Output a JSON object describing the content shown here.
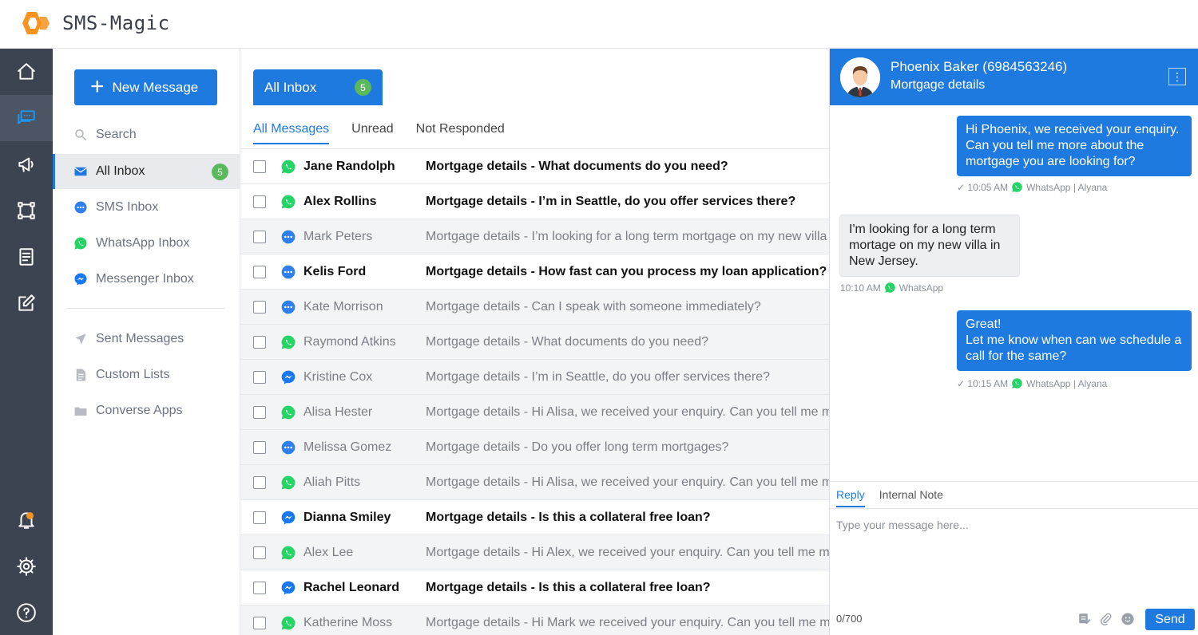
{
  "app": {
    "name": "SMS-Magic"
  },
  "rail": {
    "items": [
      "home-icon",
      "conversations-icon",
      "campaign-icon",
      "automation-icon",
      "templates-icon",
      "compose-icon",
      "notifications-icon",
      "settings-icon",
      "help-icon"
    ]
  },
  "folders": {
    "new_message_label": "New Message",
    "search_label": "Search",
    "items": [
      {
        "label": "All Inbox",
        "count": "5"
      },
      {
        "label": "SMS Inbox"
      },
      {
        "label": "WhatsApp Inbox"
      },
      {
        "label": "Messenger Inbox"
      }
    ],
    "secondary": [
      {
        "label": "Sent Messages"
      },
      {
        "label": "Custom Lists"
      },
      {
        "label": "Converse Apps"
      }
    ]
  },
  "list": {
    "inbox_tab": {
      "label": "All Inbox",
      "count": "5"
    },
    "filters": [
      "All Messages",
      "Unread",
      "Not Responded"
    ],
    "rows": [
      {
        "channel": "whatsapp",
        "name": "Jane Randolph",
        "subject": "Mortgage details - What documents do you need?",
        "unread": true
      },
      {
        "channel": "whatsapp",
        "name": "Alex Rollins",
        "subject": "Mortgage details - I’m in Seattle, do you offer services there?",
        "unread": true
      },
      {
        "channel": "sms",
        "name": "Mark Peters",
        "subject": "Mortgage details - I’m looking for a long term mortgage on my new villa in New Jersey",
        "unread": false
      },
      {
        "channel": "sms",
        "name": "Kelis Ford",
        "subject": "Mortgage details - How fast can you process my loan application?",
        "unread": true
      },
      {
        "channel": "sms",
        "name": "Kate Morrison",
        "subject": "Mortgage details - Can I speak with someone immediately?",
        "unread": false
      },
      {
        "channel": "whatsapp",
        "name": "Raymond Atkins",
        "subject": "Mortgage details - What documents do you need?",
        "unread": false
      },
      {
        "channel": "messenger",
        "name": "Kristine Cox",
        "subject": "Mortgage details - I’m in Seattle, do you offer services there?",
        "unread": false
      },
      {
        "channel": "whatsapp",
        "name": "Alisa Hester",
        "subject": "Mortgage details - Hi Alisa, we received your enquiry. Can you tell me more",
        "unread": false
      },
      {
        "channel": "sms",
        "name": "Melissa Gomez",
        "subject": "Mortgage details - Do you offer long term mortgages?",
        "unread": false
      },
      {
        "channel": "whatsapp",
        "name": "Aliah Pitts",
        "subject": "Mortgage details - Hi Alisa, we received your enquiry. Can you tell me more",
        "unread": false
      },
      {
        "channel": "messenger",
        "name": "Dianna Smiley",
        "subject": "Mortgage details - Is this a collateral free loan?",
        "unread": true
      },
      {
        "channel": "whatsapp",
        "name": "Alex Lee",
        "subject": "Mortgage details - Hi Alex, we received your enquiry. Can you tell me more",
        "unread": false
      },
      {
        "channel": "messenger",
        "name": "Rachel Leonard",
        "subject": "Mortgage details - Is this a collateral free loan?",
        "unread": true
      },
      {
        "channel": "whatsapp",
        "name": "Katherine Moss",
        "subject": "Mortgage details - Hi Mark  we received your enquiry. Can you tell me more",
        "unread": false
      }
    ]
  },
  "chat": {
    "contact": "Phoenix Baker (6984563246)",
    "subject": "Mortgage details",
    "messages": [
      {
        "direction": "out",
        "text": "Hi Phoenix, we received your enquiry. Can you tell me more about the mortgage you are looking for?",
        "time": "10:05 AM",
        "channel": "WhatsApp",
        "agent": "| Alyana"
      },
      {
        "direction": "in",
        "text": "I'm looking for a long term mortage on my new villa in New Jersey.",
        "time": "10:10 AM",
        "channel": "WhatsApp"
      },
      {
        "direction": "out",
        "text": "Great!\nLet me know when can we schedule a call for the same?",
        "time": "10:15 AM",
        "channel": "WhatsApp",
        "agent": "| Alyana"
      }
    ],
    "reply": {
      "tabs": [
        "Reply",
        "Internal Note"
      ],
      "placeholder": "Type your message here...",
      "counter": "0/700",
      "send_label": "Send"
    }
  },
  "colors": {
    "primary": "#1f7ae0",
    "rail": "#3c4452",
    "badge": "#5cb85c",
    "whatsapp": "#25d366",
    "sms": "#2f80ed",
    "messenger": "#1877f2",
    "logo_orange": "#f7931e"
  }
}
